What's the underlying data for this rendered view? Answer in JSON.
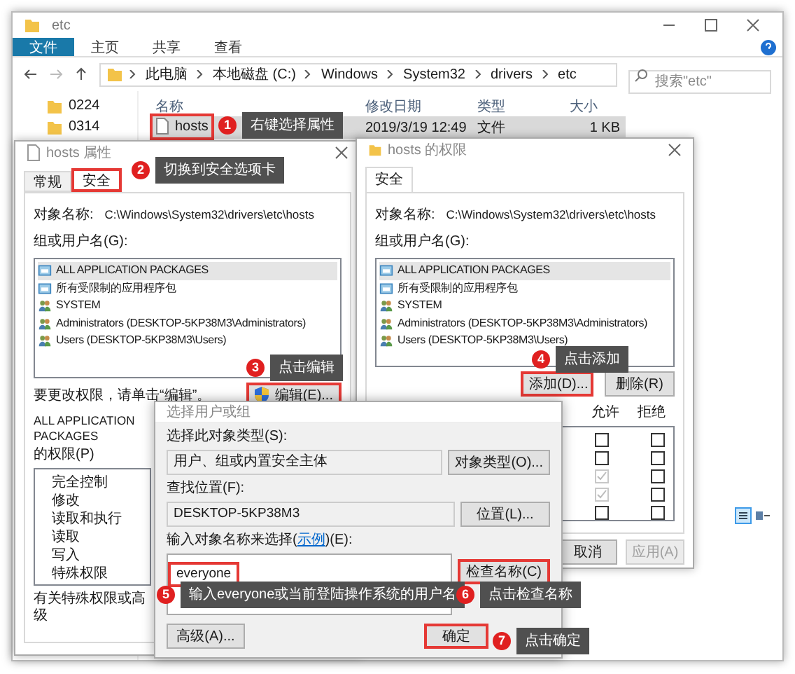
{
  "explorer": {
    "title": "etc",
    "ribbon_tabs": [
      {
        "label": "文件",
        "selected": true
      },
      {
        "label": "主页",
        "selected": false
      },
      {
        "label": "共享",
        "selected": false
      },
      {
        "label": "查看",
        "selected": false
      }
    ],
    "breadcrumb": [
      "此电脑",
      "本地磁盘 (C:)",
      "Windows",
      "System32",
      "drivers",
      "etc"
    ],
    "search": {
      "placeholder": "搜索\"etc\""
    },
    "nav_folders": [
      "0224",
      "0314"
    ],
    "columns": [
      "名称",
      "修改日期",
      "类型",
      "大小"
    ],
    "rows": [
      {
        "cells": [
          "hosts",
          "2019/3/19 12:49",
          "文件",
          "1 KB"
        ],
        "selected": true,
        "highlighted": true
      }
    ]
  },
  "properties_dialog": {
    "title": "hosts 属性",
    "tabs": [
      {
        "label": "常规",
        "selected": false,
        "highlighted": false
      },
      {
        "label": "安全",
        "selected": true,
        "highlighted": true
      }
    ],
    "object_label": "对象名称:",
    "object_value": "C:\\Windows\\System32\\drivers\\etc\\hosts",
    "group_label": "组或用户名(G):",
    "principals": [
      {
        "name": "ALL APPLICATION PACKAGES",
        "kind": "package",
        "selected": true
      },
      {
        "name": "所有受限制的应用程序包",
        "kind": "package",
        "selected": false
      },
      {
        "name": "SYSTEM",
        "kind": "users",
        "selected": false
      },
      {
        "name": "Administrators (DESKTOP-5KP38M3\\Administrators)",
        "kind": "users",
        "selected": false
      },
      {
        "name": "Users (DESKTOP-5KP38M3\\Users)",
        "kind": "users",
        "selected": false
      }
    ],
    "change_hint": "要更改权限，请单击“编辑”。",
    "edit_button": {
      "label": "编辑(E)...",
      "highlighted": true
    },
    "permissions_for": "ALL APPLICATION PACKAGES",
    "permissions_label": "的权限(P)",
    "permissions": [
      "完全控制",
      "修改",
      "读取和执行",
      "读取",
      "写入",
      "特殊权限"
    ],
    "footer_text": "有关特殊权限或高级"
  },
  "permissions_dialog": {
    "title": "hosts 的权限",
    "tabs": [
      {
        "label": "安全",
        "selected": true
      }
    ],
    "object_label": "对象名称:",
    "object_value": "C:\\Windows\\System32\\drivers\\etc\\hosts",
    "group_label": "组或用户名(G):",
    "principals": [
      {
        "name": "ALL APPLICATION PACKAGES",
        "kind": "package",
        "selected": true
      },
      {
        "name": "所有受限制的应用程序包",
        "kind": "package",
        "selected": false
      },
      {
        "name": "SYSTEM",
        "kind": "users",
        "selected": false
      },
      {
        "name": "Administrators (DESKTOP-5KP38M3\\Administrators)",
        "kind": "users",
        "selected": false
      },
      {
        "name": "Users (DESKTOP-5KP38M3\\Users)",
        "kind": "users",
        "selected": false
      }
    ],
    "add_button": {
      "label": "添加(D)...",
      "highlighted": true
    },
    "remove_button": {
      "label": "删除(R)",
      "highlighted": false
    },
    "allow_header": "允许",
    "deny_header": "拒绝",
    "checks": [
      {
        "allow": {
          "checked": false,
          "disabled": false
        },
        "deny": {
          "checked": false,
          "disabled": false
        }
      },
      {
        "allow": {
          "checked": false,
          "disabled": false
        },
        "deny": {
          "checked": false,
          "disabled": false
        }
      },
      {
        "allow": {
          "checked": true,
          "disabled": true
        },
        "deny": {
          "checked": false,
          "disabled": false
        }
      },
      {
        "allow": {
          "checked": true,
          "disabled": true
        },
        "deny": {
          "checked": false,
          "disabled": false
        }
      },
      {
        "allow": {
          "checked": false,
          "disabled": false
        },
        "deny": {
          "checked": false,
          "disabled": false
        }
      }
    ],
    "buttons": [
      {
        "label": "取消",
        "disabled": false
      },
      {
        "label": "应用(A)",
        "disabled": true
      }
    ]
  },
  "select_dialog": {
    "title": "选择用户或组",
    "type_label": "选择此对象类型(S):",
    "type_value": "用户、组或内置安全主体",
    "type_button": "对象类型(O)...",
    "location_label": "查找位置(F):",
    "location_value": "DESKTOP-5KP38M3",
    "location_button": "位置(L)...",
    "names_label_before": "输入对象名称来选择(",
    "names_link": "示例",
    "names_label_after": ")(E):",
    "names_value": "everyone",
    "names_value_highlighted": true,
    "check_button": {
      "label": "检查名称(C)",
      "highlighted": true
    },
    "advanced_button": {
      "label": "高级(A)...",
      "highlighted": false
    },
    "ok_button": {
      "label": "确定",
      "highlighted": true
    }
  },
  "annotations": [
    {
      "number": "1",
      "text": "右键选择属性"
    },
    {
      "number": "2",
      "text": "切换到安全选项卡"
    },
    {
      "number": "3",
      "text": "点击编辑"
    },
    {
      "number": "4",
      "text": "点击添加"
    },
    {
      "number": "5",
      "text": "输入everyone或当前登陆操作系统的用户名"
    },
    {
      "number": "6",
      "text": "点击检查名称"
    },
    {
      "number": "7",
      "text": "点击确定"
    }
  ]
}
